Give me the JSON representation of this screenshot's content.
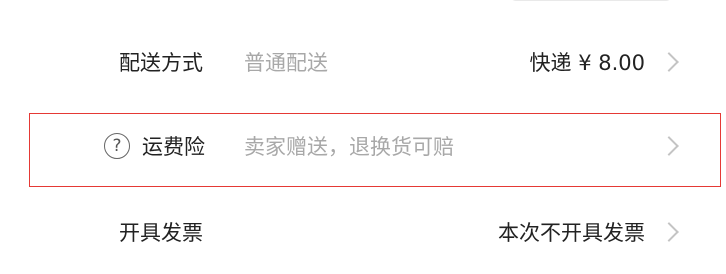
{
  "shipping": {
    "label": "配送方式",
    "description": "普通配送",
    "value": "快递 ¥ 8.00"
  },
  "insurance": {
    "icon_char": "?",
    "label": "运费险",
    "description": "卖家赠送，退换货可赔"
  },
  "invoice": {
    "label": "开具发票",
    "value": "本次不开具发票"
  },
  "colors": {
    "highlight": "#e53935",
    "text_primary": "#222222",
    "text_secondary": "#a8a8a8",
    "chevron": "#c4c4c4"
  }
}
